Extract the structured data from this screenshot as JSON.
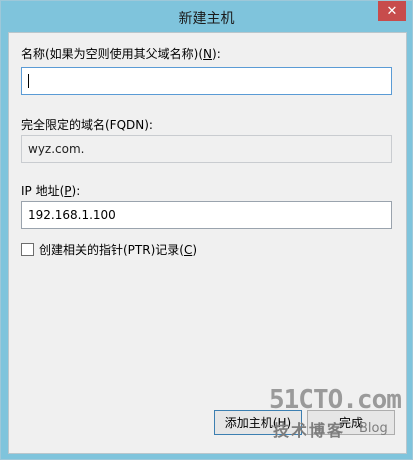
{
  "window": {
    "title": "新建主机",
    "close_glyph": "✕"
  },
  "form": {
    "name_label": "名称(如果为空则使用其父域名称)(",
    "name_hotkey": "N",
    "name_label_end": "):",
    "name_value": "",
    "fqdn_label": "完全限定的域名(FQDN):",
    "fqdn_value": "wyz.com.",
    "ip_label": "IP 地址(",
    "ip_hotkey": "P",
    "ip_label_end": "):",
    "ip_value": "192.168.1.100",
    "ptr_label": "创建相关的指针(PTR)记录(",
    "ptr_hotkey": "C",
    "ptr_label_end": ")",
    "ptr_checked": false
  },
  "buttons": {
    "add_label": "添加主机(H)",
    "done_label": "完成"
  },
  "watermark": {
    "main": "51CTO.com",
    "sub": "技术博客",
    "blog": "Blog"
  },
  "colors": {
    "titlebar": "#7fc4dc",
    "client_bg": "#f0f0f0",
    "focus_border": "#5a9bd5"
  }
}
